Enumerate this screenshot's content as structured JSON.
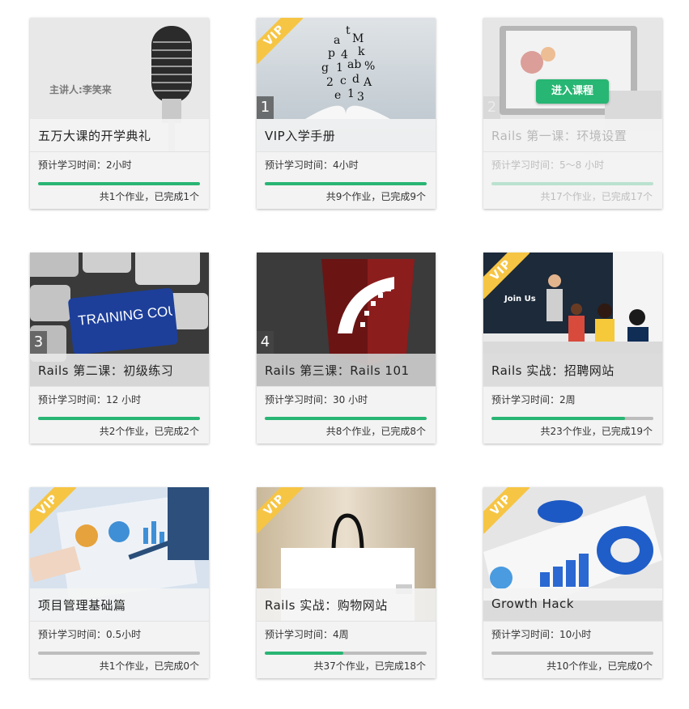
{
  "courses": [
    {
      "title": "五万大课的开学典礼",
      "time": "预计学习时间：2小时",
      "homework": "共1个作业，已完成1个",
      "progress": 1.0,
      "vip": false,
      "number": "",
      "thumb_caption": "主讲人:李笑来"
    },
    {
      "title": "VIP入学手册",
      "time": "预计学习时间：4小时",
      "homework": "共9个作业，已完成9个",
      "progress": 1.0,
      "vip": true,
      "number": "1"
    },
    {
      "title": "Rails 第一课：环境设置",
      "time": "预计学习时间：5～8 小时",
      "homework": "共17个作业，已完成17个",
      "progress": 1.0,
      "vip": false,
      "number": "2",
      "hover_button": "进入课程"
    },
    {
      "title": "Rails 第二课：初级练习",
      "time": "预计学习时间：12 小时",
      "homework": "共2个作业，已完成2个",
      "progress": 1.0,
      "vip": false,
      "number": "3",
      "thumb_caption": "TRAINING COURSES"
    },
    {
      "title": "Rails 第三课：Rails 101",
      "time": "预计学习时间：30 小时",
      "homework": "共8个作业，已完成8个",
      "progress": 1.0,
      "vip": false,
      "number": "4"
    },
    {
      "title": "Rails 实战：招聘网站",
      "time": "预计学习时间：2周",
      "homework": "共23个作业，已完成19个",
      "progress": 0.826,
      "vip": true,
      "number": "",
      "thumb_caption": "Join Us"
    },
    {
      "title": "项目管理基础篇",
      "time": "预计学习时间：0.5小时",
      "homework": "共1个作业，已完成0个",
      "progress": 0.0,
      "vip": true,
      "number": ""
    },
    {
      "title": "Rails 实战：购物网站",
      "time": "预计学习时间：4周",
      "homework": "共37个作业，已完成18个",
      "progress": 0.486,
      "vip": true,
      "number": ""
    },
    {
      "title": "Growth Hack",
      "time": "预计学习时间：10小时",
      "homework": "共10个作业，已完成0个",
      "progress": 0.0,
      "vip": true,
      "number": ""
    }
  ],
  "vip_label": "VIP",
  "colors": {
    "progress_fill": "#29b574",
    "progress_track": "#bdbdbd",
    "vip_ribbon": "#f6c544",
    "enter_button": "#27b673"
  }
}
